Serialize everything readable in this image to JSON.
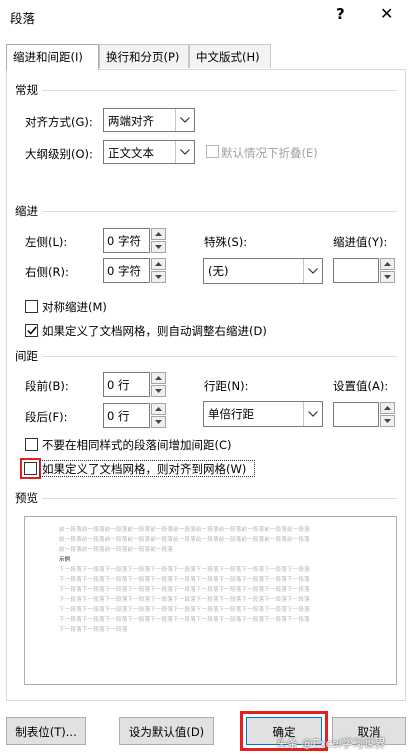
{
  "window": {
    "title": "段落",
    "help_label": "?",
    "close_label": "✕"
  },
  "tabs": [
    {
      "label": "缩进和间距(I)",
      "active": true
    },
    {
      "label": "换行和分页(P)",
      "active": false
    },
    {
      "label": "中文版式(H)",
      "active": false
    }
  ],
  "general": {
    "heading": "常规",
    "alignment_label": "对齐方式(G):",
    "alignment_value": "两端对齐",
    "outline_label": "大纲级别(O):",
    "outline_value": "正文文本",
    "collapse_label": "默认情况下折叠(E)"
  },
  "indent": {
    "heading": "缩进",
    "left_label": "左侧(L):",
    "left_value": "0 字符",
    "right_label": "右侧(R):",
    "right_value": "0 字符",
    "special_label": "特殊(S):",
    "special_value": "(无)",
    "indent_value_label": "缩进值(Y):",
    "indent_value": "",
    "mirror_label": "对称缩进(M)",
    "mirror_checked": false,
    "auto_adjust_label": "如果定义了文档网格，则自动调整右缩进(D)",
    "auto_adjust_checked": true
  },
  "spacing": {
    "heading": "间距",
    "before_label": "段前(B):",
    "before_value": "0 行",
    "after_label": "段后(F):",
    "after_value": "0 行",
    "line_spacing_label": "行距(N):",
    "line_spacing_value": "单倍行距",
    "set_value_label": "设置值(A):",
    "set_value": "",
    "no_space_same_style_label": "不要在相同样式的段落间增加间距(C)",
    "no_space_same_style_checked": false,
    "snap_to_grid_label": "如果定义了文档网格，则对齐到网格(W)",
    "snap_to_grid_checked": false
  },
  "preview": {
    "heading": "预览",
    "prev_lines": [
      "前一段落前一段落前一段落前一段落前一段落前一段落前一段落前一段落前一段落前一段落前一段落",
      "前一段落前一段落前一段落前一段落前一段落前一段落前一段落前一段落前一段落前一段落前一段落",
      "前一段落前一段落前一段落前一段落前一段落"
    ],
    "sample": "示例",
    "next_lines": [
      "下一段落下一段落下一段落下一段落下一段落下一段落下一段落下一段落下一段落下一段落下一段落",
      "下一段落下一段落下一段落下一段落下一段落下一段落下一段落下一段落下一段落下一段落下一段落",
      "下一段落下一段落下一段落下一段落下一段落下一段落下一段落下一段落下一段落下一段落下一段落",
      "下一段落下一段落下一段落下一段落下一段落下一段落下一段落下一段落下一段落下一段落下一段落",
      "下一段落下一段落下一段落下一段落下一段落下一段落下一段落下一段落下一段落下一段落下一段落",
      "下一段落下一段落下一段落下一段落下一段落下一段落下一段落下一段落下一段落下一段落下一段落",
      "下一段落下一段落下一段落"
    ]
  },
  "buttons": {
    "tabs_label": "制表位(T)...",
    "set_default_label": "设为默认值(D)",
    "ok_label": "确定",
    "cancel_label": "取消"
  },
  "watermark": "头条 @Excel学习世界",
  "colors": {
    "highlight": "#e3201b",
    "focus_blue": "#0078d7"
  }
}
